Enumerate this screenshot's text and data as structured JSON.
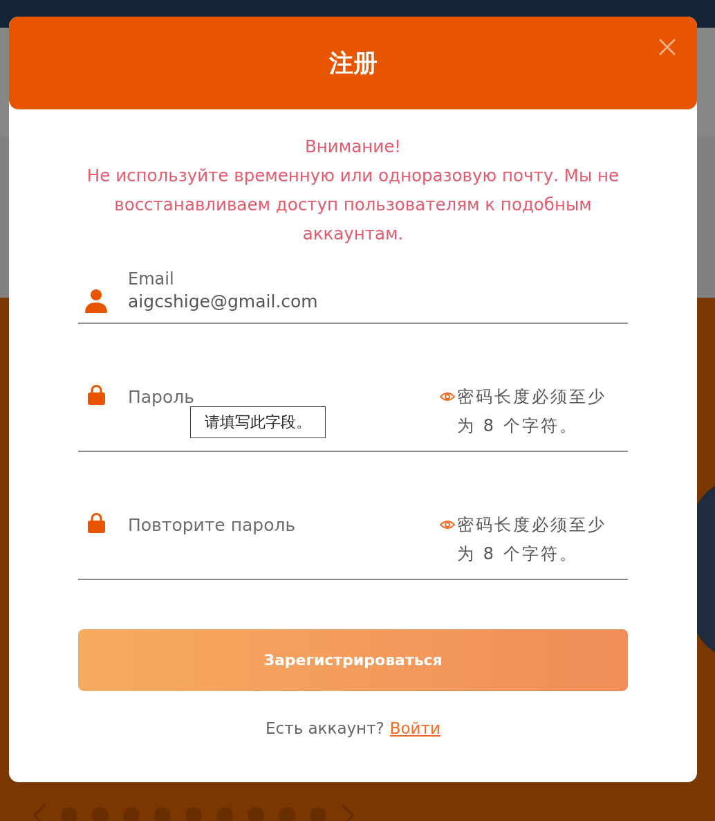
{
  "dialog": {
    "title": "注册"
  },
  "warning": {
    "title": "Внимание!",
    "text": "Не используйте временную или одноразовую почту. Мы не восстанавливаем доступ пользователям к подобным аккаунтам."
  },
  "fields": [
    {
      "kind": "email",
      "label": "Email",
      "value": "aigcshige@gmail.com"
    },
    {
      "kind": "password",
      "placeholder": "Пароль",
      "hint": "密码长度必须至少为 8 个字符。",
      "tooltip": "请填写此字段。"
    },
    {
      "kind": "password",
      "placeholder": "Повторите пароль",
      "hint": "密码长度必须至少为 8 个字符。"
    }
  ],
  "submit_button": {
    "label": "Зарегистрироваться"
  },
  "footer": {
    "prompt": "Есть аккаунт?",
    "link": "Войти"
  }
}
